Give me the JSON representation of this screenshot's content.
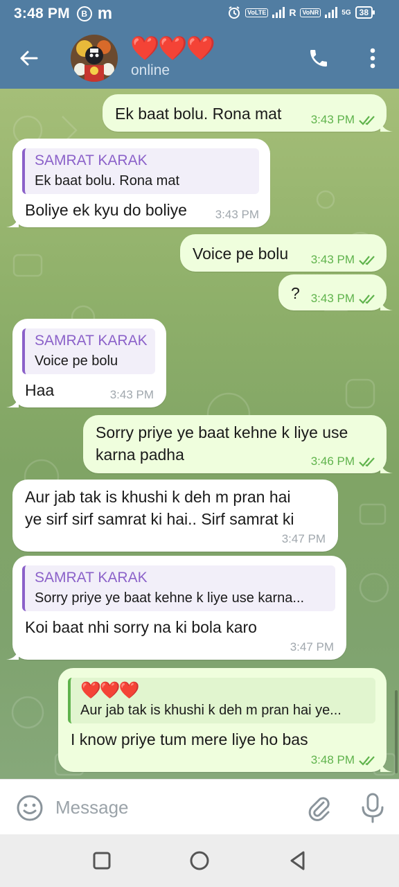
{
  "status_bar": {
    "time": "3:48 PM",
    "icon_b": "B",
    "icon_m": "m",
    "volte": "VoLTE",
    "roaming": "R",
    "vonr": "VoNR",
    "network": "5G",
    "battery": "38"
  },
  "header": {
    "name": "❤️❤️❤️",
    "status": "online"
  },
  "messages": [
    {
      "id": "m1",
      "text": "Ek baat bolu.  Rona mat",
      "time": "3:43 PM"
    },
    {
      "id": "m2",
      "reply_name": "SAMRAT KARAK",
      "reply_text": "Ek baat bolu.  Rona mat",
      "text": "Boliye ek kyu do boliye",
      "time": "3:43 PM"
    },
    {
      "id": "m3",
      "text": "Voice pe bolu",
      "time": "3:43 PM"
    },
    {
      "id": "m4",
      "text": "?",
      "time": "3:43 PM"
    },
    {
      "id": "m5",
      "reply_name": "SAMRAT KARAK",
      "reply_text": "Voice pe bolu",
      "text": "Haa",
      "time": "3:43 PM"
    },
    {
      "id": "m6",
      "line1": "Sorry priye ye baat kehne k liye use",
      "line2": "karna padha",
      "time": "3:46 PM"
    },
    {
      "id": "m7",
      "line1": "Aur jab tak is khushi k deh m pran hai",
      "line2": "ye sirf sirf samrat ki hai.. Sirf samrat ki",
      "time": "3:47 PM"
    },
    {
      "id": "m8",
      "reply_name": "SAMRAT KARAK",
      "reply_text": "Sorry priye ye baat kehne k liye use karna...",
      "text": "Koi baat nhi sorry na ki bola karo",
      "time": "3:47 PM"
    },
    {
      "id": "m9",
      "reply_name": "❤️❤️❤️",
      "reply_text": "Aur jab tak is khushi k deh m pran hai ye...",
      "text": "I know priye tum mere liye ho bas",
      "time": "3:48 PM"
    }
  ],
  "composer": {
    "placeholder": "Message"
  },
  "colors": {
    "header": "#517da2",
    "outgoing_bubble": "#effedd",
    "incoming_bubble": "#ffffff",
    "reply_name": "#8b61c9",
    "read_ticks": "#5fb34c"
  }
}
